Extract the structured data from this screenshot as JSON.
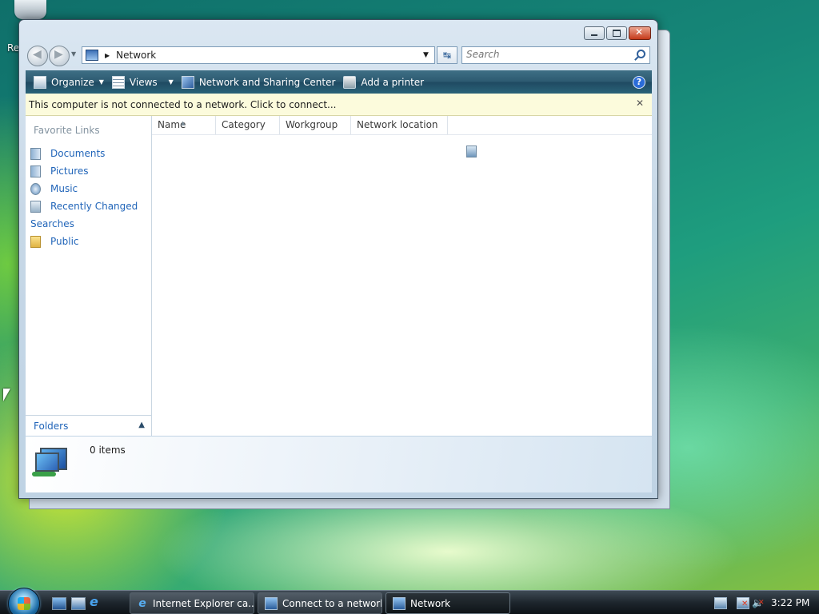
{
  "desktop": {
    "recycle_bin_label": "Re"
  },
  "window": {
    "address": {
      "current": "Network"
    },
    "search": {
      "placeholder": "Search"
    },
    "toolbar": {
      "organize": "Organize",
      "views": "Views",
      "network_sharing_center": "Network and Sharing Center",
      "add_printer": "Add a printer"
    },
    "infobar": {
      "message": "This computer is not connected to a network. Click to connect..."
    },
    "nav_pane": {
      "heading": "Favorite Links",
      "items": [
        {
          "label": "Documents",
          "icon": "documents-icon"
        },
        {
          "label": "Pictures",
          "icon": "pictures-icon"
        },
        {
          "label": "Music",
          "icon": "music-icon"
        },
        {
          "label": "Recently Changed",
          "icon": "recently-changed-icon"
        },
        {
          "label": "Searches",
          "icon": "searches-icon"
        },
        {
          "label": "Public",
          "icon": "public-folder-icon"
        }
      ],
      "folders_label": "Folders"
    },
    "columns": [
      "Name",
      "Category",
      "Workgroup",
      "Network location"
    ],
    "details": {
      "count": "0 items"
    }
  },
  "taskbar": {
    "tasks": [
      {
        "label": "Internet Explorer ca...",
        "icon": "ie-icon"
      },
      {
        "label": "Connect to a network",
        "icon": "network-icon"
      },
      {
        "label": "Network",
        "icon": "network-icon"
      }
    ],
    "clock": "3:22 PM"
  }
}
